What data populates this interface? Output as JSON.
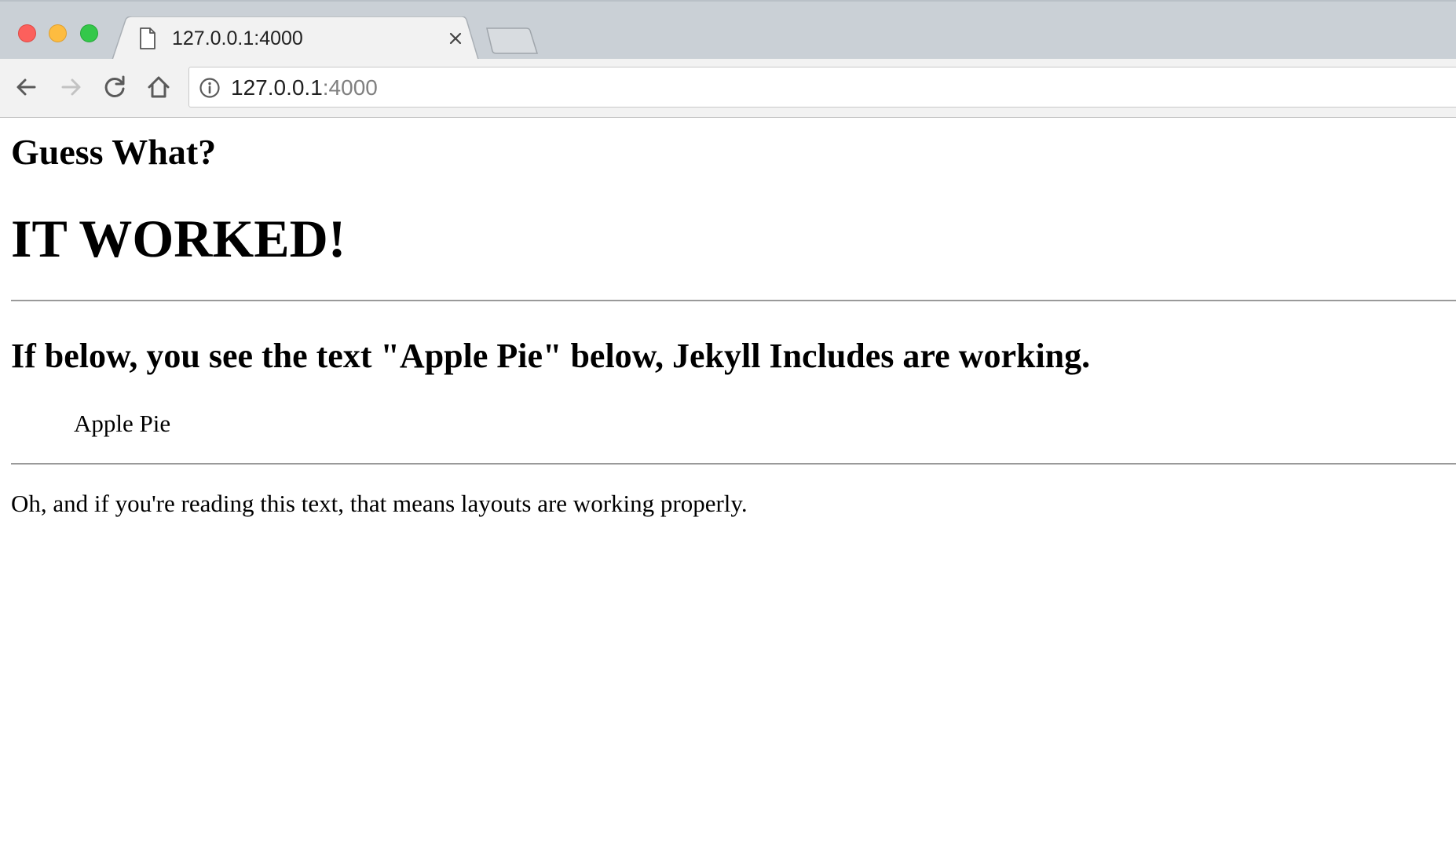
{
  "browser": {
    "tab": {
      "title": "127.0.0.1:4000"
    },
    "address_bar": {
      "host": "127.0.0.1",
      "port": ":4000"
    },
    "icons": {
      "tab_favicon": "document-icon",
      "tab_close": "close-icon",
      "back": "arrow-left-icon",
      "forward": "arrow-right-icon",
      "reload": "reload-icon",
      "home": "home-icon",
      "site_info": "info-icon"
    },
    "colors": {
      "close_light": "#fc605c",
      "minimize_light": "#fdbc40",
      "maximize_light": "#34c84a"
    }
  },
  "page": {
    "heading_small": "Guess What?",
    "heading_large": "IT WORKED!",
    "includes_heading": "If below, you see the text \"Apple Pie\" below, Jekyll Includes are working.",
    "include_content": "Apple Pie",
    "layout_note": "Oh, and if you're reading this text, that means layouts are working properly."
  }
}
